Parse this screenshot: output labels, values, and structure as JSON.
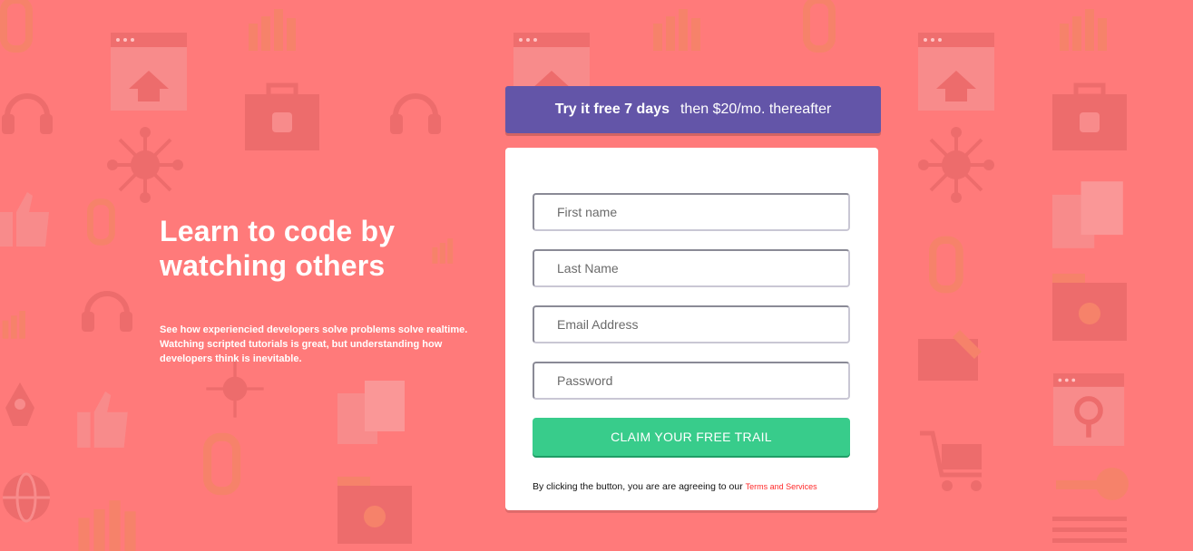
{
  "intro": {
    "heading": "Learn to code by watching others",
    "description": "See how experiencied developers solve problems solve realtime. Watching scripted tutorials is great, but understanding how developers think is inevitable."
  },
  "promo": {
    "strong": "Try it free 7 days",
    "rest": "then $20/mo. thereafter"
  },
  "form": {
    "first_name_placeholder": "First name",
    "last_name_placeholder": "Last Name",
    "email_placeholder": "Email Address",
    "password_placeholder": "Password",
    "submit_label": "CLAIM YOUR FREE TRAIL",
    "terms_text": "By clicking the button, you are are agreeing to our",
    "terms_link": "Terms and Services"
  },
  "colors": {
    "background": "#ff7a7a",
    "promo": "#6355a8",
    "cta": "#38cc8b",
    "link": "#ff2a2a"
  }
}
